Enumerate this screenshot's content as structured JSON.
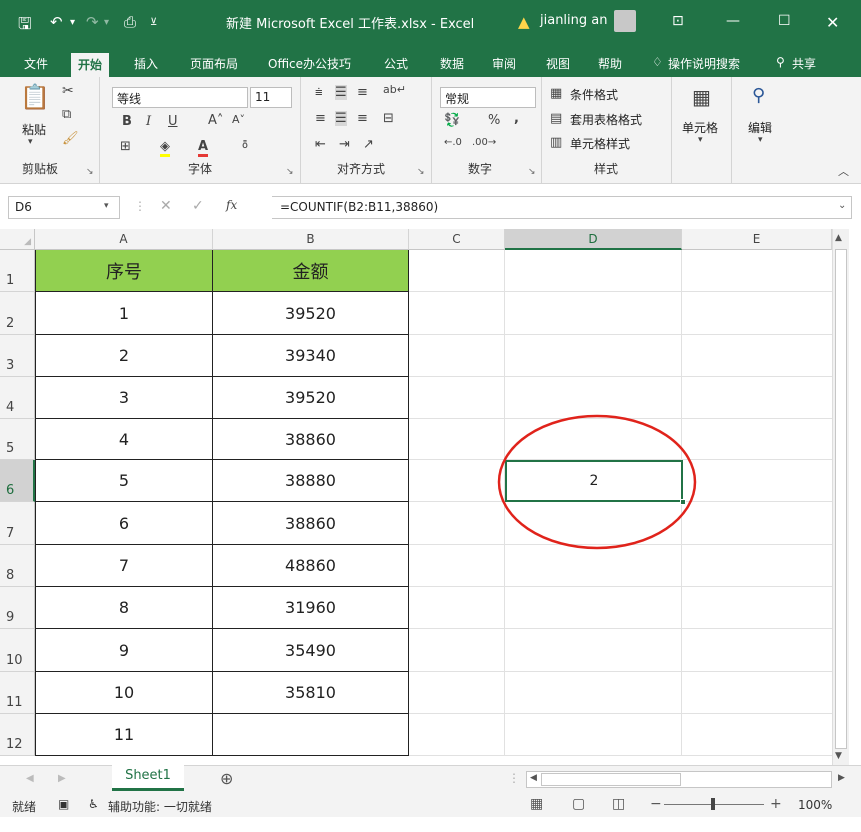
{
  "window": {
    "title": "新建 Microsoft Excel 工作表.xlsx  -  Excel",
    "user": "jianling an",
    "warning_icon": "warning-icon",
    "accent_color": "#217346"
  },
  "tabs": [
    "文件",
    "开始",
    "插入",
    "页面布局",
    "Office办公技巧",
    "公式",
    "数据",
    "审阅",
    "视图",
    "帮助"
  ],
  "active_tab": "开始",
  "search": {
    "label": "操作说明搜索"
  },
  "share": {
    "label": "共享"
  },
  "ribbon": {
    "clipboard": {
      "label": "剪贴板",
      "paste": "粘贴"
    },
    "font": {
      "label": "字体",
      "name": "等线",
      "size": "11",
      "bold": "B",
      "italic": "I",
      "underline": "U"
    },
    "alignment": {
      "label": "对齐方式"
    },
    "number": {
      "label": "数字",
      "format": "常规",
      "percent": "%",
      "comma": ","
    },
    "styles": {
      "label": "样式",
      "conditional": "条件格式",
      "table": "套用表格格式",
      "cell": "单元格样式"
    },
    "cells": {
      "label": "单元格"
    },
    "editing": {
      "label": "编辑"
    }
  },
  "formula_bar": {
    "name_box": "D6",
    "fx": "fx",
    "formula": "=COUNTIF(B2:B11,38860)"
  },
  "columns": [
    "A",
    "B",
    "C",
    "D",
    "E"
  ],
  "selected_column": "D",
  "rows": [
    "1",
    "2",
    "3",
    "4",
    "5",
    "6",
    "7",
    "8",
    "9",
    "10",
    "11",
    "12"
  ],
  "selected_row": "6",
  "table": {
    "header_fill": "#92d050",
    "headers": [
      "序号",
      "金额"
    ],
    "data": [
      [
        "1",
        "39520"
      ],
      [
        "2",
        "39340"
      ],
      [
        "3",
        "39520"
      ],
      [
        "4",
        "38860"
      ],
      [
        "5",
        "38880"
      ],
      [
        "6",
        "38860"
      ],
      [
        "7",
        "48860"
      ],
      [
        "8",
        "31960"
      ],
      [
        "9",
        "35490"
      ],
      [
        "10",
        "35810"
      ],
      [
        "11",
        ""
      ]
    ]
  },
  "active_cell": {
    "ref": "D6",
    "value": "2"
  },
  "annotation": {
    "color": "#e0231b"
  },
  "sheets": [
    "Sheet1"
  ],
  "status": {
    "ready": "就绪",
    "accessibility": "辅助功能: 一切就绪",
    "zoom": "100%"
  }
}
